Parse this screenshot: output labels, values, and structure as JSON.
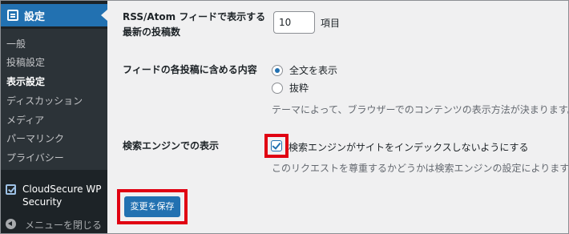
{
  "sidebar": {
    "current_menu": "設定",
    "submenu": [
      "一般",
      "投稿設定",
      "表示設定",
      "ディスカッション",
      "メディア",
      "パーマリンク",
      "プライバシー"
    ],
    "active_submenu": "表示設定",
    "plugin_label": "CloudSecure WP Security",
    "collapse_label": "メニューを閉じる"
  },
  "settings": {
    "feed_count": {
      "label": "RSS/Atom フィードで表示する最新の投稿数",
      "label_line1": "RSS/Atom フィードで表示する",
      "label_line2": "最新の投稿数",
      "value": "10",
      "unit": "項目"
    },
    "feed_content": {
      "label": "フィードの各投稿に含める内容",
      "options": [
        "全文を表示",
        "抜粋"
      ],
      "selected": "全文を表示",
      "description": "テーマによって、ブラウザーでのコンテンツの表示方法が決まります。"
    },
    "search_engine": {
      "label": "検索エンジンでの表示",
      "checkbox_label": "検索エンジンがサイトをインデックスしないようにする",
      "checked": true,
      "description": "このリクエストを尊重するかどうかは検索エンジンの設定によります。"
    }
  },
  "save_button": "変更を保存",
  "colors": {
    "sidebar_bg": "#1d2327",
    "submenu_bg": "#2c3338",
    "accent": "#2271b1",
    "highlight": "#e00012"
  }
}
